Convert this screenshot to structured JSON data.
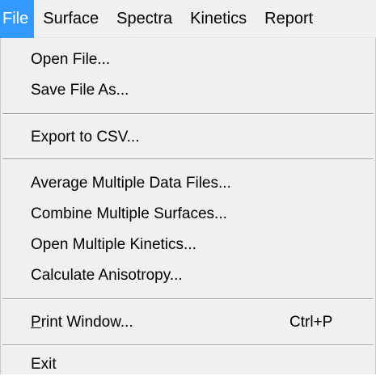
{
  "menubar": {
    "items": [
      {
        "label": "File"
      },
      {
        "label": "Surface"
      },
      {
        "label": "Spectra"
      },
      {
        "label": "Kinetics"
      },
      {
        "label": "Report"
      }
    ]
  },
  "file_menu": {
    "open_file": "Open File...",
    "save_file_as": "Save File As...",
    "export_csv": "Export to CSV...",
    "average_multiple": "Average Multiple Data Files...",
    "combine_surfaces": "Combine Multiple Surfaces...",
    "open_multiple_kinetics": "Open Multiple Kinetics...",
    "calculate_anisotropy": "Calculate Anisotropy...",
    "print_window_mnemonic": "P",
    "print_window_rest": "rint Window...",
    "print_window_shortcut": "Ctrl+P",
    "exit": "Exit"
  },
  "colors": {
    "highlight": "#3399ff",
    "menu_background": "#f0f0f0"
  }
}
